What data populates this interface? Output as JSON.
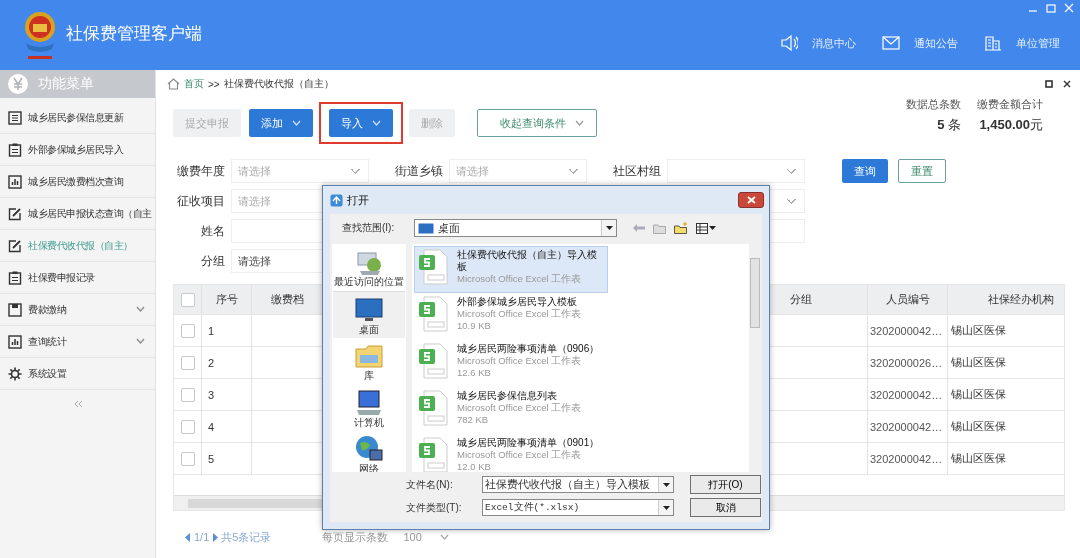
{
  "app": {
    "title": "社保费管理客户端"
  },
  "header_links": [
    {
      "label": "消息中心",
      "kind": "speaker"
    },
    {
      "label": "通知公告",
      "kind": "mail"
    },
    {
      "label": "单位管理",
      "kind": "building"
    }
  ],
  "sidebar": {
    "title": "功能菜单",
    "items": [
      {
        "label": "城乡居民参保信息更新",
        "kind": "list",
        "selected": false,
        "expandable": false
      },
      {
        "label": "外部参保城乡居民导入",
        "kind": "clipboard",
        "selected": false,
        "expandable": false
      },
      {
        "label": "城乡居民缴费档次查询",
        "kind": "chart",
        "selected": false,
        "expandable": false
      },
      {
        "label": "城乡居民申报状态查询（自主",
        "kind": "edit",
        "selected": false,
        "expandable": false
      },
      {
        "label": "社保费代收代报（自主）",
        "kind": "edit",
        "selected": true,
        "expandable": false
      },
      {
        "label": "社保费申报记录",
        "kind": "clipboard",
        "selected": false,
        "expandable": false
      },
      {
        "label": "费款缴纳",
        "kind": "panel",
        "selected": false,
        "expandable": true
      },
      {
        "label": "查询统计",
        "kind": "chart",
        "selected": false,
        "expandable": true
      },
      {
        "label": "系统设置",
        "kind": "gear",
        "selected": false,
        "expandable": false
      }
    ]
  },
  "breadcrumb": {
    "home": "首页",
    "separator": ">>",
    "current": "社保费代收代报（自主）"
  },
  "toolbar": [
    {
      "label": "提交申报",
      "kind": "solid",
      "disabled": true,
      "dropdown": false,
      "highlighted": false
    },
    {
      "label": "添加",
      "kind": "solid",
      "disabled": false,
      "dropdown": true,
      "highlighted": false
    },
    {
      "label": "导入",
      "kind": "solid",
      "disabled": false,
      "dropdown": true,
      "highlighted": true
    },
    {
      "label": "删除",
      "kind": "solid",
      "disabled": true,
      "dropdown": false,
      "highlighted": false
    },
    {
      "label": "收起查询条件",
      "kind": "outline",
      "disabled": false,
      "dropdown": true,
      "highlighted": false
    }
  ],
  "summary": [
    {
      "label": "数据总条数",
      "value": "**5** 条"
    },
    {
      "label": "缴费金额合计",
      "value": "**1,450.00**元"
    }
  ],
  "filters": [
    [
      {
        "label": "缴费年度",
        "kind": "select",
        "placeholder": "请选择"
      },
      {
        "label": "街道乡镇",
        "kind": "select",
        "placeholder": "请选择"
      },
      {
        "label": "社区村组",
        "kind": "select"
      }
    ],
    [
      {
        "label": "征收项目",
        "kind": "select",
        "placeholder": "请选择"
      },
      {
        "kind": "select"
      }
    ],
    [
      {
        "label": "姓名",
        "kind": "input"
      },
      {
        "kind": "input"
      }
    ],
    [
      {
        "label": "分组",
        "kind": "select",
        "value": "请选择"
      }
    ]
  ],
  "filter_buttons": [
    {
      "label": "查询",
      "kind": "primary"
    },
    {
      "label": "重置",
      "kind": "outline"
    }
  ],
  "table": {
    "header_checked": false,
    "columns": [
      "序号",
      "缴费档",
      "分组",
      "人员编号",
      "社保经办机构"
    ],
    "rows": [
      {
        "checked": false,
        "number": "1",
        "person_id": "3202000042…",
        "agency": "锡山区医保"
      },
      {
        "checked": false,
        "number": "2",
        "person_id": "3202000026…",
        "agency": "锡山区医保"
      },
      {
        "checked": false,
        "number": "3",
        "person_id": "3202000042…",
        "agency": "锡山区医保"
      },
      {
        "checked": false,
        "number": "4",
        "person_id": "3202000042…",
        "agency": "锡山区医保"
      },
      {
        "checked": false,
        "number": "5",
        "person_id": "3202000042…",
        "agency": "锡山区医保"
      }
    ]
  },
  "pagination": {
    "page": "1/1",
    "total": "共5条记录",
    "page_size_label": "每页显示条数",
    "page_size": "100"
  },
  "dialog": {
    "title": "打开",
    "look_in_label": "查找范围(I):",
    "look_in": "桌面",
    "places": [
      {
        "label": "最近访问的位置",
        "kind": "recent",
        "selected": false
      },
      {
        "label": "桌面",
        "kind": "desktop",
        "selected": true
      },
      {
        "label": "库",
        "kind": "library",
        "selected": false
      },
      {
        "label": "计算机",
        "kind": "computer",
        "selected": false
      },
      {
        "label": "网络",
        "kind": "network",
        "selected": false
      }
    ],
    "files": [
      {
        "name": "社保费代收代报（自主）导入模板",
        "type": "Microsoft Office Excel 工作表",
        "selected": true
      },
      {
        "name": "外部参保城乡居民导入模板",
        "type": "Microsoft Office Excel 工作表",
        "size": "10.9 KB",
        "selected": false
      },
      {
        "name": "城乡居民两险事项清单（0906）",
        "type": "Microsoft Office Excel 工作表",
        "size": "12.6 KB",
        "selected": false
      },
      {
        "name": "城乡居民参保信息列表",
        "type": "Microsoft Office Excel 工作表",
        "size": "782 KB",
        "selected": false
      },
      {
        "name": "城乡居民两险事项清单（0901）",
        "type": "Microsoft Office Excel 工作表",
        "size": "12.0 KB",
        "selected": false
      }
    ],
    "file_name_label": "文件名(N):",
    "file_name": "社保费代收代报（自主）导入模板",
    "file_type_label": "文件类型(T):",
    "file_type": "Excel文件(*.xlsx)",
    "buttons": [
      "打开(O)",
      "取消"
    ]
  }
}
